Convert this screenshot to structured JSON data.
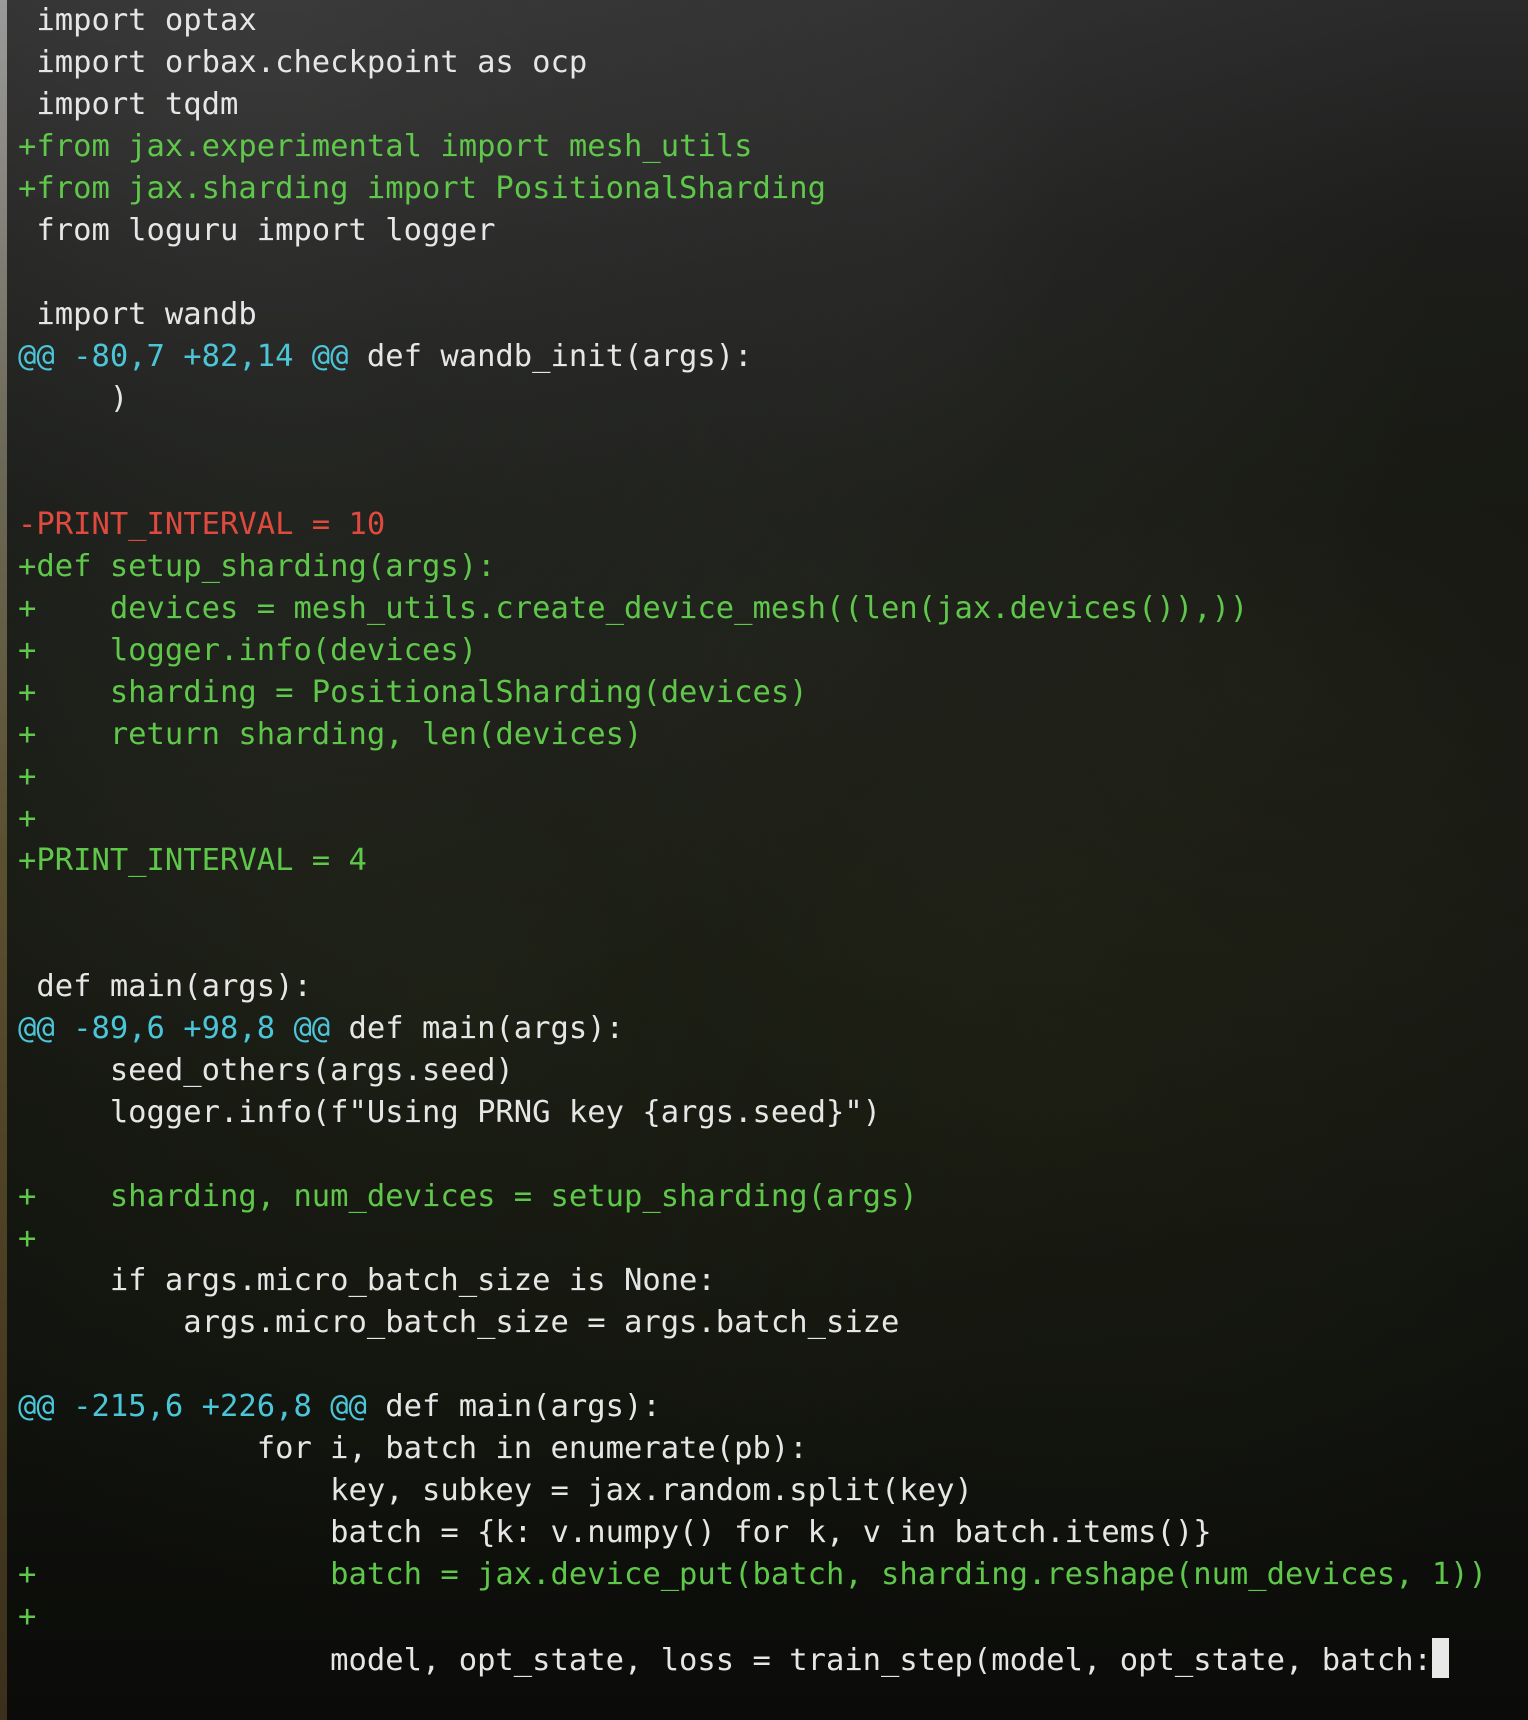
{
  "terminal": {
    "lines": [
      {
        "kind": "ctx",
        "text": " import optax"
      },
      {
        "kind": "ctx",
        "text": " import orbax.checkpoint as ocp"
      },
      {
        "kind": "ctx",
        "text": " import tqdm"
      },
      {
        "kind": "add",
        "text": "+from jax.experimental import mesh_utils"
      },
      {
        "kind": "add",
        "text": "+from jax.sharding import PositionalSharding"
      },
      {
        "kind": "ctx",
        "text": " from loguru import logger"
      },
      {
        "kind": "ctx",
        "text": ""
      },
      {
        "kind": "ctx",
        "text": " import wandb"
      },
      {
        "kind": "hunk",
        "marker": "@@ -80,7 +82,14 @@",
        "text": " def wandb_init(args):"
      },
      {
        "kind": "ctx",
        "text": "     )"
      },
      {
        "kind": "ctx",
        "text": ""
      },
      {
        "kind": "ctx",
        "text": ""
      },
      {
        "kind": "del",
        "text": "-PRINT_INTERVAL = 10"
      },
      {
        "kind": "add",
        "text": "+def setup_sharding(args):"
      },
      {
        "kind": "add",
        "text": "+    devices = mesh_utils.create_device_mesh((len(jax.devices()),))"
      },
      {
        "kind": "add",
        "text": "+    logger.info(devices)"
      },
      {
        "kind": "add",
        "text": "+    sharding = PositionalSharding(devices)"
      },
      {
        "kind": "add",
        "text": "+    return sharding, len(devices)"
      },
      {
        "kind": "add",
        "text": "+"
      },
      {
        "kind": "add",
        "text": "+"
      },
      {
        "kind": "add",
        "text": "+PRINT_INTERVAL = 4"
      },
      {
        "kind": "ctx",
        "text": ""
      },
      {
        "kind": "ctx",
        "text": ""
      },
      {
        "kind": "ctx",
        "text": " def main(args):"
      },
      {
        "kind": "hunk",
        "marker": "@@ -89,6 +98,8 @@",
        "text": " def main(args):"
      },
      {
        "kind": "ctx",
        "text": "     seed_others(args.seed)"
      },
      {
        "kind": "ctx",
        "text": "     logger.info(f\"Using PRNG key {args.seed}\")"
      },
      {
        "kind": "ctx",
        "text": ""
      },
      {
        "kind": "add",
        "text": "+    sharding, num_devices = setup_sharding(args)"
      },
      {
        "kind": "add",
        "text": "+"
      },
      {
        "kind": "ctx",
        "text": "     if args.micro_batch_size is None:"
      },
      {
        "kind": "ctx",
        "text": "         args.micro_batch_size = args.batch_size"
      },
      {
        "kind": "ctx",
        "text": ""
      },
      {
        "kind": "hunk",
        "marker": "@@ -215,6 +226,8 @@",
        "text": " def main(args):"
      },
      {
        "kind": "ctx",
        "text": "             for i, batch in enumerate(pb):"
      },
      {
        "kind": "ctx",
        "text": "                 key, subkey = jax.random.split(key)"
      },
      {
        "kind": "ctx",
        "text": "                 batch = {k: v.numpy() for k, v in batch.items()}"
      },
      {
        "kind": "add",
        "text": "+                batch = jax.device_put(batch, sharding.reshape(num_devices, 1))"
      },
      {
        "kind": "add",
        "text": "+"
      },
      {
        "kind": "ctx",
        "text": "                 model, opt_state, loss = train_step(model, opt_state, batch:",
        "cursor": true
      }
    ]
  },
  "colors": {
    "context": "#e6e6e6",
    "added": "#5fc74a",
    "removed": "#df4a3e",
    "hunk_header": "#4cc5d8",
    "cursor": "#e8e8e8"
  }
}
